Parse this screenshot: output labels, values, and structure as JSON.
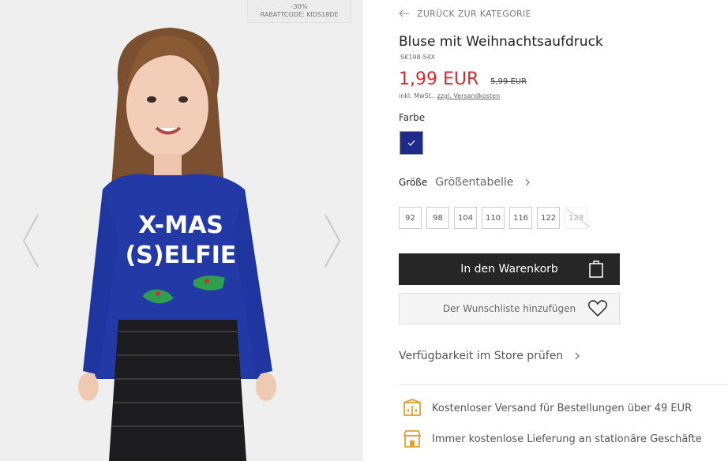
{
  "promo": {
    "discount": "-30%",
    "code": "RABATTCODE: KIDS18DE"
  },
  "nav": {
    "back_label": "ZURÜCK ZUR KATEGORIE"
  },
  "product": {
    "title": "Bluse mit Weihnachtsaufdruck",
    "sku": "SK198-54X",
    "price": "1,99 EUR",
    "old_price": "5,99 EUR",
    "tax_prefix": "inkl. MwSt., ",
    "tax_link": "zzgl. Versandkosten",
    "shirt_text_line1": "X-MAS",
    "shirt_text_line2": "(S)ELFIE"
  },
  "color": {
    "label": "Farbe",
    "selected_hex": "#1e2b8a"
  },
  "size": {
    "label": "Größe",
    "chart_link": "Größentabelle",
    "options": [
      {
        "label": "92",
        "available": true
      },
      {
        "label": "98",
        "available": true
      },
      {
        "label": "104",
        "available": true
      },
      {
        "label": "110",
        "available": true
      },
      {
        "label": "116",
        "available": true
      },
      {
        "label": "122",
        "available": true
      },
      {
        "label": "128",
        "available": false
      }
    ]
  },
  "actions": {
    "cart_label": "In den Warenkorb",
    "wishlist_label": "Der Wunschliste hinzufügen",
    "store_label": "Verfügbarkeit im Store prüfen"
  },
  "features": [
    {
      "icon": "shipping-box-icon",
      "text": "Kostenloser Versand für Bestellungen über 49 EUR"
    },
    {
      "icon": "store-icon",
      "text": "Immer kostenlose Lieferung an stationäre Geschäfte"
    }
  ],
  "colors": {
    "accent_price": "#d9292e",
    "feature_icon": "#e0a232",
    "button_dark": "#262626"
  }
}
